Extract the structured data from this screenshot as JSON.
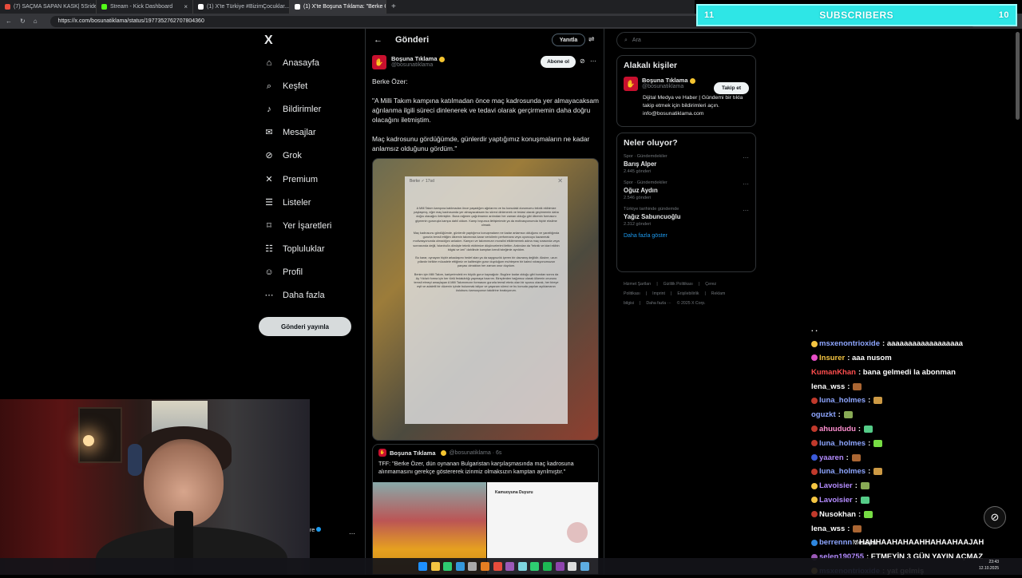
{
  "browser": {
    "tabs": [
      {
        "label": "(7) SAÇMA SAPAN KASK| 5Sriden...",
        "color": "#e74c3c",
        "active": false
      },
      {
        "label": "Stream - Kick Dashboard",
        "color": "#53fc18",
        "active": false
      },
      {
        "label": "(1) X'te Türkiye #BizimÇocuklar...",
        "color": "#ffffff",
        "active": false
      },
      {
        "label": "(1) X'te Boşuna Tıklama: \"Berke Ö...",
        "color": "#ffffff",
        "active": true
      }
    ],
    "url": "https://x.com/bosunatiklama/status/1977352762707804360"
  },
  "overlay": {
    "subscribers_label": "SUBSCRIBERS",
    "left_count": "11",
    "right_count": "10"
  },
  "nav": {
    "logo": "X",
    "items": [
      {
        "label": "Anasayfa",
        "icon": "home-icon",
        "glyph": "⌂"
      },
      {
        "label": "Keşfet",
        "icon": "search-icon",
        "glyph": "⌕"
      },
      {
        "label": "Bildirimler",
        "icon": "bell-icon",
        "glyph": "♪"
      },
      {
        "label": "Mesajlar",
        "icon": "mail-icon",
        "glyph": "✉"
      },
      {
        "label": "Grok",
        "icon": "grok-icon",
        "glyph": "⊘"
      },
      {
        "label": "Premium",
        "icon": "x-premium-icon",
        "glyph": "✕"
      },
      {
        "label": "Listeler",
        "icon": "list-icon",
        "glyph": "☰"
      },
      {
        "label": "Yer İşaretleri",
        "icon": "bookmark-icon",
        "glyph": "⌑"
      },
      {
        "label": "Topluluklar",
        "icon": "people-icon",
        "glyph": "☷"
      },
      {
        "label": "Profil",
        "icon": "profile-icon",
        "glyph": "☺"
      },
      {
        "label": "Daha fazla",
        "icon": "more-circle-icon",
        "glyph": "⋯"
      }
    ],
    "notification_badge": "1",
    "post_button": "Gönderi yayınla",
    "profile_suffix": "re"
  },
  "main": {
    "header_title": "Gönderi",
    "reply_button": "Yanıtla",
    "author": {
      "name": "Boşuna Tıklama",
      "handle": "@bosunatiklama"
    },
    "subscribe_button": "Abone ol",
    "tweet_paragraphs": [
      "Berke Özer:",
      "\"A Milli Takım kampına katılmadan önce maç kadrosunda yer almayacaksam ağrılanma ilgili süreci dinlenerek ve tedavi olarak gerçirmemin daha doğru olacağını iletmiştim.",
      "Maç kadrosunu gördüğümde, günlerdir yaptığımız konuşmaların ne kadar anlamsız olduğunu gördüm.\""
    ],
    "statement": {
      "header": "Berke ✓ 17sd",
      "paragraphs": [
        "A Milli Takım kampına katılmadan önce yaşadığım ağrılarımı ve bu konudaki durumumu teknik ekibimize paylaşmış, eğer maç kadrosunda yer almayacaksam bu süreci dinlenerek ve tedavi olarak geçirmemin daha doğru olacağını iletmiştim. Buna rağmen çağrılmamın ardından her zaman olduğu gibi ülkemin formasını giymenin gururuyla kampa dahil oldum. Kamp boyunca iletişimimde ya da motivasyonumda hiçbir eksilme olmadı.",
        "Maç kadrosunu gördüğümde, günlerdir yaptığımız konuşmaların ne kadar anlamsız olduğunu ve yarattığında gururla temsil ettiğim ülkemin takımında karar vericilerin performans veya oyuncuyu kazanmak motivasyonunda olmadığını anladım. Kampın ve takımımızın moralini etkilememek adına maç sırasında veya sonrasında değil, İstanbul'a dönüşte teknik ekibimize düşüncelerimi ilettim. Ardından da \"teknik ve idari ekibin bilgisi ve izni\" dahilinde kamptan kendi isteğimle ayrıldım.",
        "Bu karar, oynayan hiçbir arkadaşımı hedef alan ya da saygısızlık içeren bir davranış değildir. Aksine, uzun yıllardır birlikte mücadele ettiğimiz ve kalitesiyle gurur duyduğum muhteşem bir kaleci rotasyonumuzun parçası olmaktan her zaman onur duydum.",
        "Benim için Milli Takım, kariyerimdeki en büyük gurur kaynağıdır. Bugüne kadar olduğu gibi bundan sonra da Ay Yıldızlı forma için her türlü fedakârlığı yapmaya hazırım. Bireylerden bağımsız olarak ülkemin onurunu temsil etmeyi amaçlayan A Milli Takımımızın formasını gururla temsil etmis olan bir sporcu olarak, her bireye eşit ve adaletli bir düzenin içinde bulunmak istiyor ve yaşanan süreci ve bu konuda yapılan açıklamanın üslubunu kamuoyunun takdirine bırakıyorum."
      ]
    },
    "quote": {
      "name": "Boşuna Tıklama",
      "handle": "@bosunatiklama · 6s",
      "text": "TFF: \"Berke Özer, dün oynanan Bulgaristan karşılaşmasında maç kadrosuna alınmamasını gerekçe göstererek izinmiz olmaksızın kamptan ayrılmıştır.\"",
      "doc_title": "Kamuoyuna Duyuru"
    }
  },
  "right": {
    "search_placeholder": "Ara",
    "related_title": "Alakalı kişiler",
    "related_user": {
      "name": "Boşuna Tıklama",
      "handle": "@bosunatiklama",
      "bio": "Dijital Medya ve Haber | Gündemi bir tıkla takip etmek için bildirimleri açın. info@bosunatiklama.com"
    },
    "follow_button": "Takip et",
    "trends_title": "Neler oluyor?",
    "trends": [
      {
        "category": "Spor · Gündemdekiler",
        "name": "Barış Alper",
        "count": "2.445 gönderi"
      },
      {
        "category": "Spor · Gündemdekiler",
        "name": "Oğuz Aydın",
        "count": "2.546 gönderi"
      },
      {
        "category": "Türkiye tarihinde gündemde",
        "name": "Yağız Sabuncuoğlu",
        "count": "2.312 gönderi"
      }
    ],
    "show_more": "Daha fazla göster",
    "footer_links": [
      "Hizmet Şartları",
      "|",
      "Gizlilik Politikası",
      "|",
      "Çerez Politikası",
      "|",
      "Imprint",
      "|",
      "Erişilebilirlik",
      "|",
      "Reklam bilgisi",
      "|",
      "Daha fazla ···",
      "© 2025 X Corp."
    ]
  },
  "chat": {
    "messages": [
      {
        "user": ". .",
        "text": "",
        "color": "#ffffff",
        "badge": ""
      },
      {
        "user": "msxenontrioxide",
        "text": ": aaaaaaaaaaaaaaaaaa",
        "color": "#8ea6ff",
        "badge": "#f5c542"
      },
      {
        "user": "Insurer",
        "text": ": aaa nusom",
        "color": "#f5c542",
        "badge": "#e84fc7"
      },
      {
        "user": "KumanKhan",
        "text": ": bana gelmedi la abonman",
        "color": "#ff4d4d",
        "badge": ""
      },
      {
        "user": "lena_wss",
        "text": ":",
        "color": "#ffffff",
        "badge": ""
      },
      {
        "user": "luna_holmes",
        "text": ":",
        "color": "#8ea6ff",
        "badge": "#c0392b"
      },
      {
        "user": "oguzkt",
        "text": ":",
        "color": "#8ea6ff",
        "badge": ""
      },
      {
        "user": "ahuududu",
        "text": ":",
        "color": "#ff8fd0",
        "badge": "#c0392b"
      },
      {
        "user": "luna_holmes",
        "text": ":",
        "color": "#8ea6ff",
        "badge": "#c0392b"
      },
      {
        "user": "yaaren",
        "text": ":",
        "color": "#b48cff",
        "badge": "#3b5bdb"
      },
      {
        "user": "luna_holmes",
        "text": ":",
        "color": "#8ea6ff",
        "badge": "#c0392b"
      },
      {
        "user": "Lavoisier",
        "text": ":",
        "color": "#b48cff",
        "badge": "#f5c542"
      },
      {
        "user": "Lavoisier",
        "text": ":",
        "color": "#b48cff",
        "badge": "#f5c542"
      },
      {
        "user": "Nusokhan",
        "text": ":",
        "color": "#ffffff",
        "badge": "#c0392b"
      },
      {
        "user": "lena_wss",
        "text": ":",
        "color": "#ffffff",
        "badge": ""
      },
      {
        "user": "berrennn",
        "text": ": HAHHAAHAHAAHHAHAAHAAJAH",
        "color": "#8ea6ff",
        "badge": "#2e86de"
      },
      {
        "user": "selen190755",
        "text": ": ETMEYİN 3 GÜN YAYIN AÇMAZ",
        "color": "#b48cff",
        "badge": "#9b59b6"
      },
      {
        "user": "msxenontrioxide",
        "text": ": yat gelmiş",
        "color": "#8ea6ff",
        "badge": "#f5c542"
      }
    ],
    "tray_label": "Mesajlar"
  },
  "taskbar": {
    "time": "23:43",
    "date": "12.10.2025"
  }
}
